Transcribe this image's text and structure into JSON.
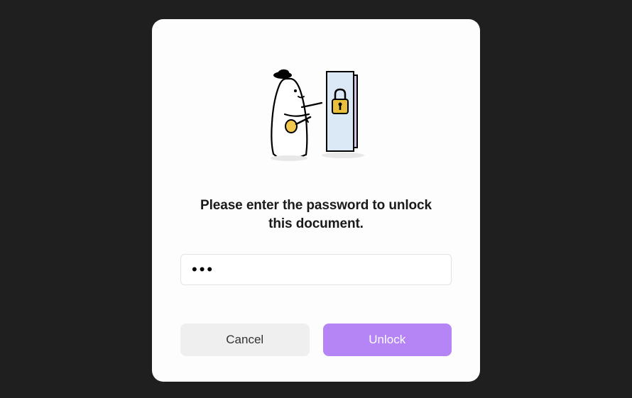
{
  "dialog": {
    "prompt": "Please enter the password to unlock this document.",
    "password_value": "•••",
    "buttons": {
      "cancel_label": "Cancel",
      "unlock_label": "Unlock"
    }
  },
  "illustration": {
    "name": "character-unlock-document",
    "colors": {
      "page_front": "#dbe8f6",
      "page_back": "#d3c3e6",
      "key": "#f2c94c",
      "lock": "#e8bf3e",
      "hat": "#000000",
      "outline": "#000000"
    }
  }
}
